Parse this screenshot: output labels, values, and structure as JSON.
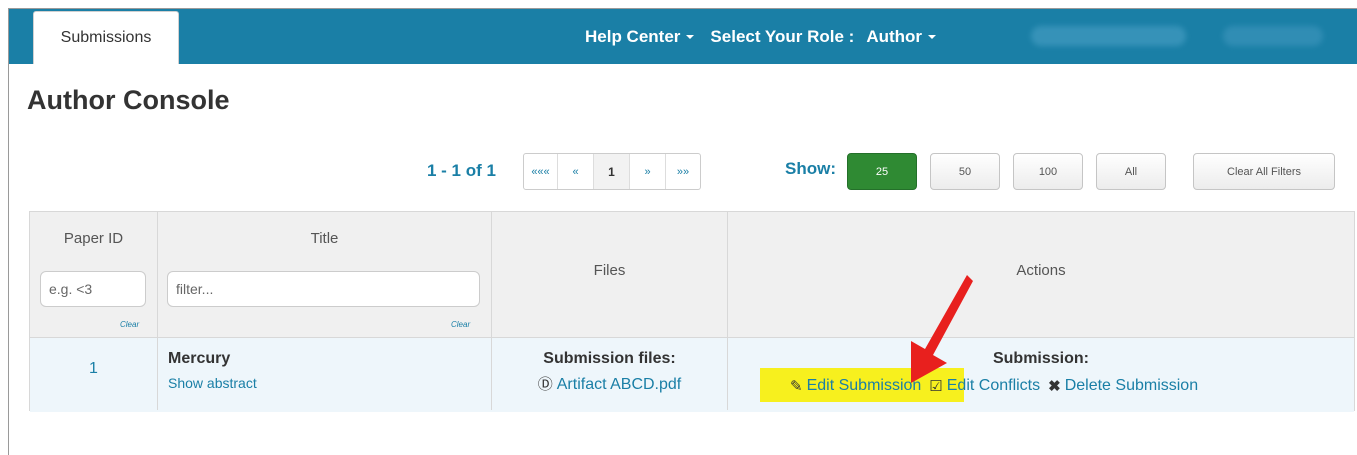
{
  "nav": {
    "tab": "Submissions",
    "help": "Help Center",
    "role_label": "Select Your Role :",
    "role_value": "Author"
  },
  "page": {
    "title": "Author Console"
  },
  "pager": {
    "count": "1 - 1 of 1",
    "first": "«««",
    "prev": "«",
    "current": "1",
    "next": "»",
    "last": "»»"
  },
  "show": {
    "label": "Show:",
    "options": [
      "25",
      "50",
      "100",
      "All"
    ],
    "selected": "25",
    "clear_filters": "Clear All Filters"
  },
  "table": {
    "headers": {
      "paper_id": "Paper ID",
      "title": "Title",
      "files": "Files",
      "actions": "Actions"
    },
    "filters": {
      "id_placeholder": "e.g. <3",
      "title_placeholder": "filter...",
      "clear": "Clear"
    },
    "rows": [
      {
        "id": "1",
        "title": "Mercury",
        "abstract_link": "Show abstract",
        "files_label": "Submission files:",
        "file": "Artifact ABCD.pdf",
        "actions_label": "Submission:",
        "edit": "Edit Submission",
        "conflicts": "Edit Conflicts",
        "delete": "Delete Submission"
      }
    ]
  },
  "colors": {
    "nav": "#1a7fa6",
    "accent": "#1a7fa6",
    "active_button": "#2f8a33",
    "highlight": "#f7f01e",
    "arrow": "#e8201e"
  },
  "icons": [
    "caret-down-icon",
    "download-circle-icon",
    "edit-icon",
    "checkbox-icon",
    "delete-x-icon",
    "red-arrow-annotation"
  ]
}
